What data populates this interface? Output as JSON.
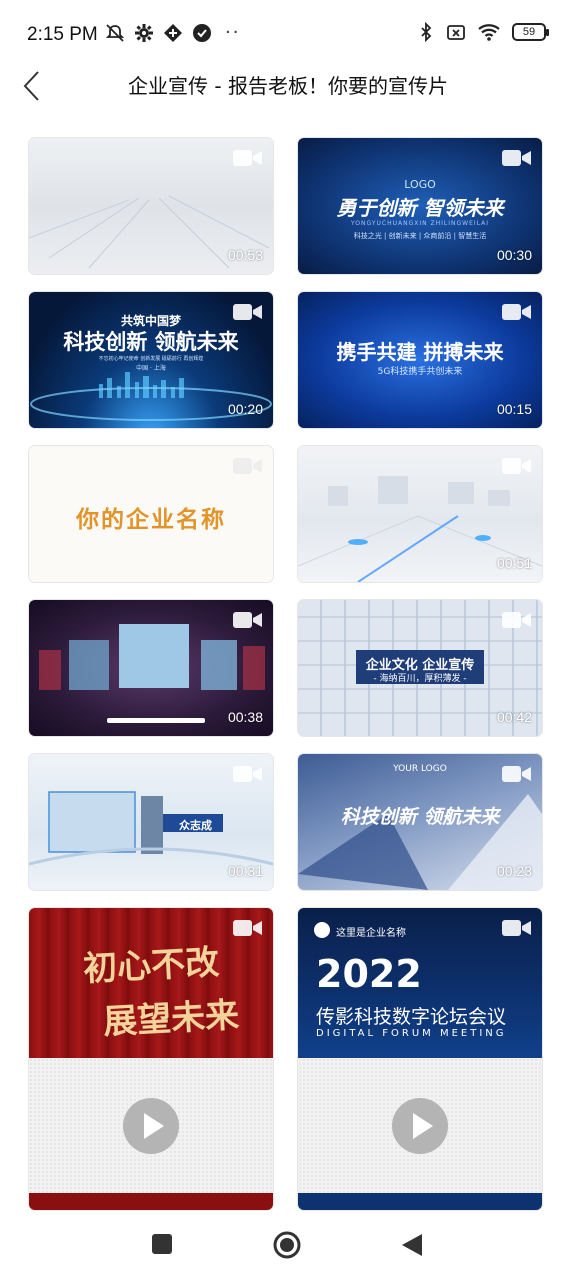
{
  "status_bar": {
    "time": "2:15 PM",
    "battery": "59",
    "icons": [
      "mute-icon",
      "gear-icon",
      "app-icon",
      "check-circle-icon",
      "more-dots-icon",
      "bluetooth-icon",
      "sim-off-icon",
      "wifi-icon",
      "battery-icon"
    ]
  },
  "header": {
    "title": "企业宣传 - 报告老板！你要的宣传片"
  },
  "videos": [
    {
      "duration": "00:53",
      "lines": []
    },
    {
      "duration": "00:30",
      "lines": [
        "LOGO",
        "勇于创新 智领未来",
        "YONGYUCHUANGXIN ZHILINGWEILAI",
        "科技之光 | 创新未来 | 众商前沿 | 智慧生活"
      ]
    },
    {
      "duration": "00:20",
      "lines": [
        "共筑中国梦",
        "科技创新 领航未来",
        "不忘初心牢记使命 创新发展 砥砺前行 再创辉煌",
        "中国 · 上海"
      ]
    },
    {
      "duration": "00:15",
      "lines": [
        "携手共建 拼搏未来",
        "5G科技携手共创未来"
      ]
    },
    {
      "duration": "",
      "lines": [
        "你的企业名称"
      ]
    },
    {
      "duration": "00:51",
      "lines": []
    },
    {
      "duration": "00:38",
      "lines": []
    },
    {
      "duration": "00:42",
      "lines": [
        "企业文化 企业宣传",
        "- 海纳百川，厚积薄发 -"
      ]
    },
    {
      "duration": "00:31",
      "lines": [
        "众志成"
      ]
    },
    {
      "duration": "00:23",
      "lines": [
        "YOUR LOGO",
        "科技创新 领航未来"
      ]
    },
    {
      "duration": "",
      "lines": [
        "初心不改",
        "展望未来"
      ]
    },
    {
      "duration": "",
      "lines": [
        "这里是企业名称",
        "2022",
        "传影科技数字论坛会议",
        "DIGITAL FORUM MEETING"
      ]
    }
  ],
  "colors": {
    "text_dark": "#111111",
    "duration_text": "#ffffff",
    "play_button": "#b4b4b4"
  },
  "nav": {
    "icons": [
      "recents-square-icon",
      "home-circle-icon",
      "back-triangle-icon"
    ]
  }
}
